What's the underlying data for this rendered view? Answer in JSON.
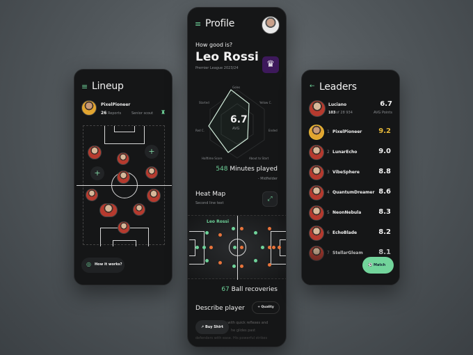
{
  "colors": {
    "accent": "#6fd39a",
    "orange": "#e8743b",
    "gold": "#e7b93a",
    "league": "#3d195b"
  },
  "lineup": {
    "title": "Lineup",
    "user": "PixelPioneer",
    "reports_count": "26",
    "reports_label": "Reports",
    "role": "Senior scout",
    "help_button": "How it works?"
  },
  "profile": {
    "title": "Profile",
    "question": "How good is?",
    "player": "Leo Rossi",
    "league": "Premier League 2023/24",
    "radar": {
      "avg": "6.7",
      "avg_label": "AVG",
      "labels": [
        "Goles",
        "Yellow C.",
        "Ended",
        "About to Start",
        "Halftime Score",
        "Red C.",
        "Started"
      ]
    },
    "minutes_value": "548",
    "minutes_label": "Minutes played",
    "position": "- Midfielder",
    "heatmap_title": "Heat Map",
    "heatmap_sub": "Second line text",
    "heatmap_player": "Leo Rossi",
    "recoveries_value": "67",
    "recoveries_label": "Ball recoveries",
    "describe_title": "Describe player",
    "quality_button": "Quality",
    "describe_lines": [
      "player with quick reflexes and",
      "he glides past",
      "defenders with ease. His powerful strikes"
    ],
    "buy_button": "Buy Shirt"
  },
  "leaders": {
    "title": "Leaders",
    "me": {
      "name": "Luciano",
      "rank": "103",
      "of": "of 28 934",
      "score": "6.7",
      "score_label": "AVG Points"
    },
    "rows": [
      {
        "rank": "1",
        "name": "PixelPioneer",
        "score": "9.2"
      },
      {
        "rank": "2",
        "name": "LunarEcho",
        "score": "9.0"
      },
      {
        "rank": "3",
        "name": "VibeSphere",
        "score": "8.8"
      },
      {
        "rank": "4",
        "name": "QuantumDreamer",
        "score": "8.6"
      },
      {
        "rank": "5",
        "name": "NeonNebula",
        "score": "8.3"
      },
      {
        "rank": "6",
        "name": "EchoBlade",
        "score": "8.2"
      },
      {
        "rank": "7",
        "name": "StellarGleam",
        "score": "8.1"
      }
    ],
    "match_button": "Match"
  }
}
